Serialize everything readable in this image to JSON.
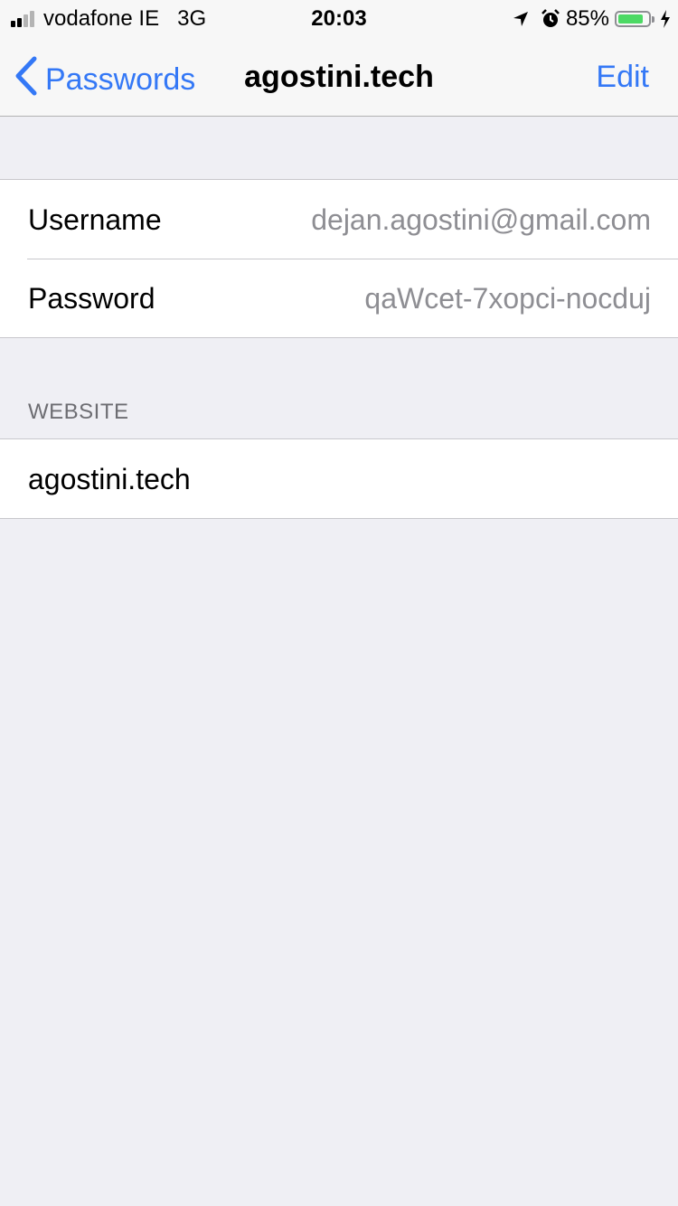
{
  "status_bar": {
    "carrier": "vodafone IE",
    "network": "3G",
    "time": "20:03",
    "battery_percent": "85%",
    "battery_level": 0.85,
    "signal_bars_filled": 2,
    "signal_bars_total": 4,
    "icons": [
      "location-arrow-icon",
      "alarm-clock-icon",
      "battery-icon",
      "charging-bolt-icon"
    ],
    "colors": {
      "battery_fill": "#4cd964",
      "signal_on": "#000000",
      "signal_off": "#b4b4b4"
    }
  },
  "nav": {
    "back_label": "Passwords",
    "title": "agostini.tech",
    "edit_label": "Edit",
    "tint_color": "#3478f6"
  },
  "credentials": {
    "rows": [
      {
        "label": "Username",
        "value": "dejan.agostini@gmail.com"
      },
      {
        "label": "Password",
        "value": "qaWcet-7xopci-nocduj"
      }
    ]
  },
  "website": {
    "header": "WEBSITE",
    "url": "agostini.tech"
  }
}
